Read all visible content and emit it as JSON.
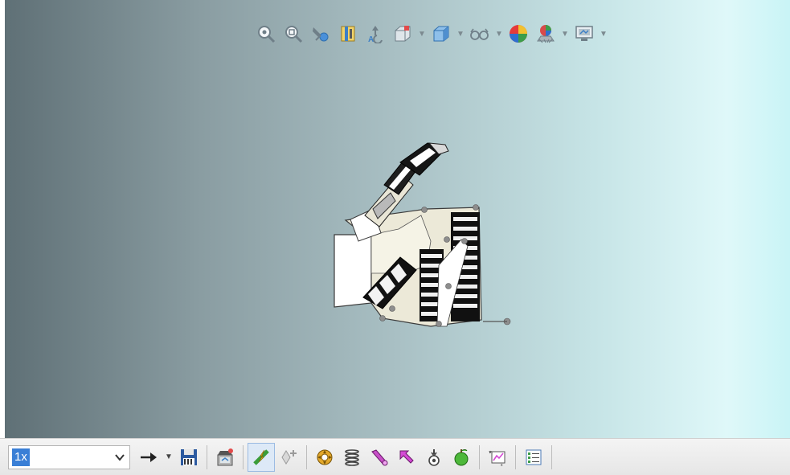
{
  "colors": {
    "accent": "#3a7fd6",
    "viewport_left": "#5f7076",
    "viewport_right": "#c9f4f6",
    "toolbar_bg": "#ececec"
  },
  "heads_up_toolbar": {
    "icons": [
      "zoom-to-fit-icon",
      "zoom-to-area-icon",
      "previous-view-icon",
      "section-view-icon",
      "dynamic-annotation-icon",
      "view-orientation-icon",
      "display-style-icon",
      "hide-show-items-icon",
      "edit-appearance-icon",
      "apply-scene-icon",
      "view-settings-icon"
    ]
  },
  "motion_toolbar": {
    "playback_speed": {
      "value": "1x"
    },
    "icons": [
      "playback-mode-icon",
      "save-animation-icon",
      "animation-wizard-icon",
      "autokey-icon",
      "add-update-key-icon",
      "motor-icon",
      "spring-icon",
      "contact-icon",
      "force-icon",
      "gravity-icon",
      "calculate-icon",
      "results-plots-icon",
      "motion-study-properties-icon"
    ]
  }
}
